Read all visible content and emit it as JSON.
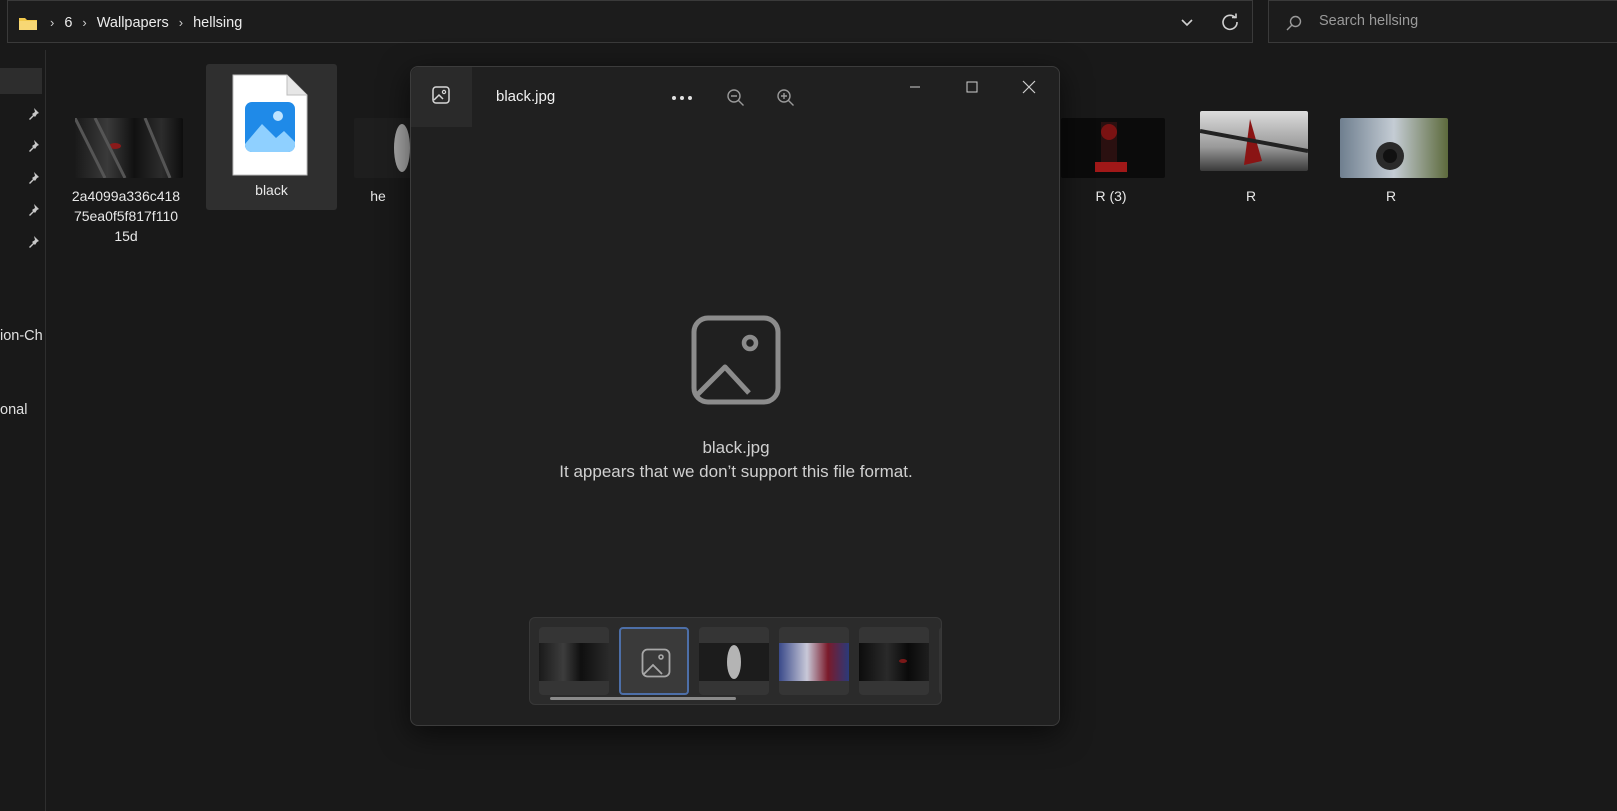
{
  "explorer": {
    "breadcrumb": [
      "6",
      "Wallpapers",
      "hellsing"
    ],
    "search_placeholder": "Search hellsing",
    "nav_labels": [
      "ion-Ch",
      "onal"
    ],
    "files": [
      {
        "name": "2a4099a336c418\n75ea0f5f817f110\n15d"
      },
      {
        "name": "black"
      },
      {
        "name": "he"
      },
      {
        "name": "R (3)"
      },
      {
        "name": "R"
      },
      {
        "name": "R"
      }
    ]
  },
  "viewer": {
    "title": "black.jpg",
    "message_filename": "black.jpg",
    "message_error": "It appears that we don’t support this file format.",
    "filmstrip_count": 5,
    "selected_index": 1
  },
  "colors": {
    "background": "#191919",
    "viewer_bg": "#202020",
    "accent": "#4d6fa8",
    "folder": "#f2c94c"
  }
}
